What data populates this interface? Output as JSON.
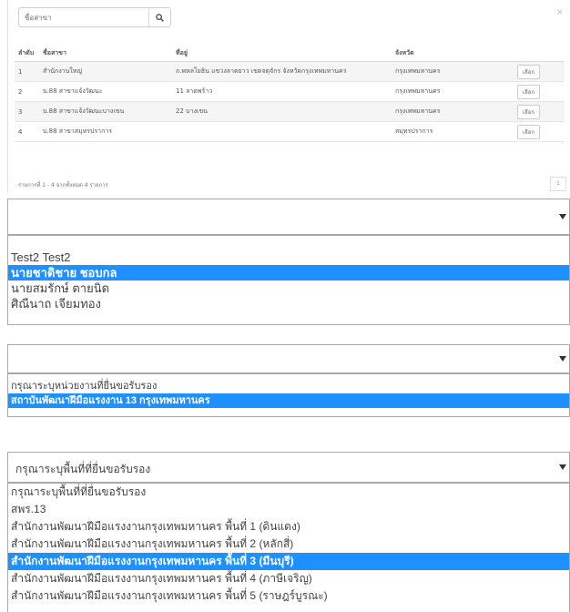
{
  "branch_lookup": {
    "search": {
      "placeholder": "ชื่อสาขา"
    },
    "close_label": "×",
    "columns": [
      "ลำดับ",
      "ชื่อสาขา",
      "ที่อยู่",
      "จังหวัด"
    ],
    "rows": [
      {
        "no": "1",
        "name": "สำนักงานใหญ่",
        "address": "ถ.พหลโยธิน แขวงลาดยาว เขตจตุจักร จังหวัดกรุงเทพมหานคร",
        "province": "กรุงเทพมหานคร",
        "action": "เลือก"
      },
      {
        "no": "2",
        "name": "บ.88 สาขาแจ้งวัฒนะ",
        "address": "11 ลาดพร้าว",
        "province": "กรุงเทพมหานคร",
        "action": "เลือก"
      },
      {
        "no": "3",
        "name": "บ.88 สาขาแจ้งวัฒนะบางเขน",
        "address": "22 บางเขน",
        "province": "กรุงเทพมหานคร",
        "action": "เลือก"
      },
      {
        "no": "4",
        "name": "บ.88 สาขาสมุทรปราการ",
        "address": "",
        "province": "สมุทรปราการ",
        "action": "เลือก"
      }
    ],
    "summary": "รายการที่ 1 - 4 จากทั้งหมด 4 รายการ",
    "pager": "1"
  },
  "person_select": {
    "value": "",
    "options": [
      {
        "label": "Test2 Test2",
        "highlighted": false
      },
      {
        "label": "นายชาติชาย ชอบกล",
        "highlighted": true
      },
      {
        "label": "นายสมรักษ์ ตายนิด",
        "highlighted": false
      },
      {
        "label": "ศิณีนาถ เจียมทอง",
        "highlighted": false
      }
    ]
  },
  "agency_select": {
    "value": "",
    "options": [
      {
        "label": "กรุณาระบุหน่วยงานที่ยื่นขอรับรอง",
        "highlighted": false
      },
      {
        "label": "สถาบันพัฒนาฝีมือแรงงาน 13 กรุงเทพมหานคร",
        "highlighted": true
      }
    ]
  },
  "area_select": {
    "value": "กรุณาระบุพื้นที่ที่ยื่นขอรับรอง",
    "options": [
      {
        "label": "กรุณาระบุพื้นที่ที่ยื่นขอรับรอง",
        "highlighted": false
      },
      {
        "label": "สพร.13",
        "highlighted": false
      },
      {
        "label": "สำนักงานพัฒนาฝีมือแรงงานกรุงเทพมหานคร พื้นที่ 1 (ดินแดง)",
        "highlighted": false
      },
      {
        "label": "สำนักงานพัฒนาฝีมือแรงงานกรุงเทพมหานคร พื้นที่ 2 (หลักสี่)",
        "highlighted": false
      },
      {
        "label": "สำนักงานพัฒนาฝีมือแรงงานกรุงเทพมหานคร พื้นที่ 3 (มีนบุรี)",
        "highlighted": true
      },
      {
        "label": "สำนักงานพัฒนาฝีมือแรงงานกรุงเทพมหานคร พื้นที่ 4 (ภาษีเจริญ)",
        "highlighted": false
      },
      {
        "label": "สำนักงานพัฒนาฝีมือแรงงานกรุงเทพมหานคร พื้นที่ 5 (ราษฎร์บูรณะ)",
        "highlighted": false
      }
    ]
  },
  "colors": {
    "highlight": "#1e90ff",
    "border": "#a9a9a9"
  }
}
